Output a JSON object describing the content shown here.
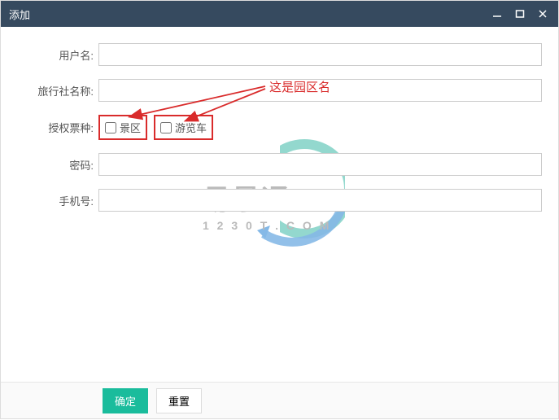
{
  "titlebar": {
    "title": "添加"
  },
  "form": {
    "username_label": "用户名:",
    "agency_label": "旅行社名称:",
    "ticket_label": "授权票种:",
    "ticket_options": {
      "opt1": "景区",
      "opt2": "游览车"
    },
    "password_label": "密码:",
    "phone_label": "手机号:"
  },
  "annotation": {
    "text": "这是园区名"
  },
  "watermark": {
    "brand": "易景通",
    "site": "1 2 3 0 T . C O M"
  },
  "buttons": {
    "ok": "确定",
    "reset": "重置"
  }
}
